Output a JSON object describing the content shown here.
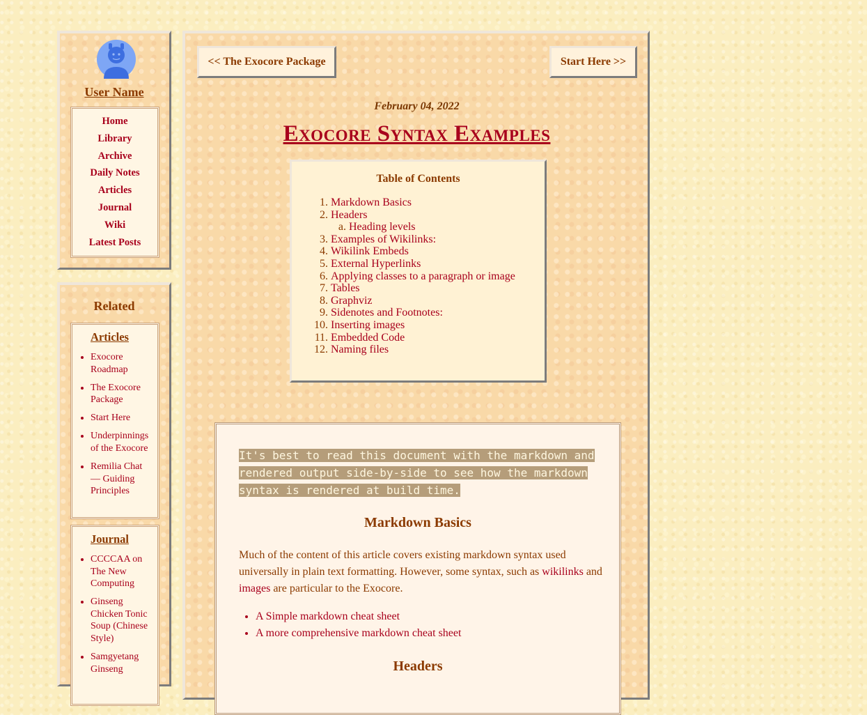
{
  "sidebar": {
    "user_name": "User Name",
    "nav": [
      "Home",
      "Library",
      "Archive",
      "Daily Notes",
      "Articles",
      "Journal",
      "Wiki",
      "Latest Posts"
    ],
    "related_title": "Related",
    "articles_heading": "Articles",
    "articles": [
      "Exocore Roadmap",
      "The Exocore Package",
      "Start Here",
      "Underpinnings of the Exocore",
      "Remilia Chat — Guiding Principles"
    ],
    "journal_heading": "Journal",
    "journal": [
      "CCCCAA on The New Computing",
      "Ginseng Chicken Tonic Soup (Chinese Style)",
      "Samgyetang Ginseng"
    ]
  },
  "main": {
    "prev_label": "<< The Exocore Package",
    "next_label": "Start Here >>",
    "date": "February 04, 2022",
    "title": "Exocore Syntax Examples",
    "toc_title": "Table of Contents",
    "toc": [
      "Markdown Basics",
      "Headers",
      "Heading levels",
      "Examples of Wikilinks:",
      "Wikilink Embeds",
      "External Hyperlinks",
      "Applying classes to a paragraph or image",
      "Tables",
      "Graphviz",
      "Sidenotes and Footnotes:",
      "Inserting images",
      "Embedded Code",
      "Naming files"
    ],
    "intro_note": "It's best to read this document with the markdown and rendered output side-by-side to see how the markdown syntax is rendered at build time.",
    "h_markdown_basics": "Markdown Basics",
    "basics_text_1": "Much of the content of this article covers existing markdown syntax used universally in plain text formatting. However, some syntax, such as",
    "basics_link_wikilinks": "wikilinks",
    "basics_text_2": "and",
    "basics_link_images": "images",
    "basics_text_3": "are particular to the Exocore.",
    "cheat_sheets": [
      "A Simple markdown cheat sheet",
      "A more comprehensive markdown cheat sheet"
    ],
    "h_headers": "Headers"
  },
  "colors": {
    "link": "#a8001c",
    "text": "#8b3a00",
    "background": "#fbeec0",
    "panel": "#f9d9a8"
  }
}
